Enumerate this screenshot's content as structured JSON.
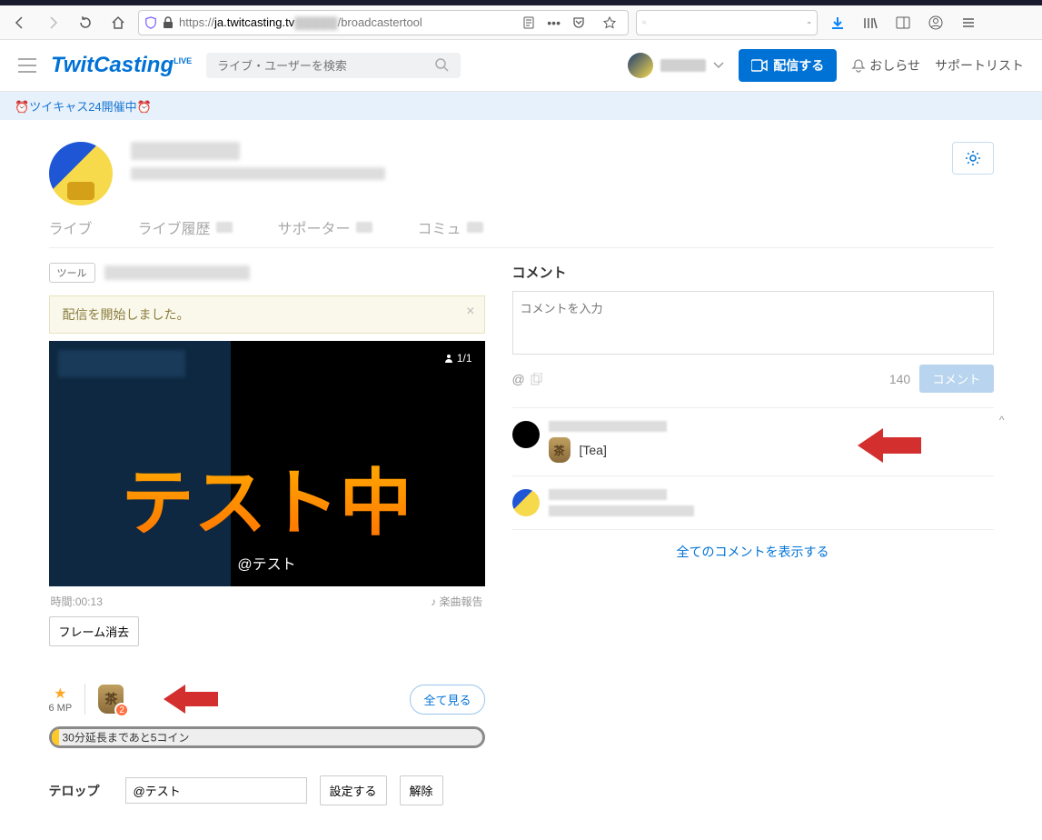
{
  "browser": {
    "url_prefix": "https://",
    "url_domain": "ja.twitcasting.tv",
    "url_suffix": "/broadcastertool"
  },
  "header": {
    "logo": "TwitCasting",
    "logo_sup": "LIVE",
    "search_placeholder": "ライブ・ユーザーを検索",
    "broadcast_btn": "配信する",
    "notice_link": "おしらせ",
    "support_link": "サポートリスト"
  },
  "banner": {
    "text": "ツイキャス24開催中",
    "emoji": "⏰"
  },
  "tabs": {
    "live": "ライブ",
    "history": "ライブ履歴",
    "supporter": "サポーター",
    "community": "コミュ"
  },
  "tool": {
    "label": "ツール"
  },
  "notice": {
    "text": "配信を開始しました。"
  },
  "player": {
    "viewer_count": "1/1",
    "overlay_text": "テスト中",
    "overlay_sub": "@テスト",
    "time_label": "時間:00:13",
    "music_report": "♪ 楽曲報告",
    "clear_frame": "フレーム消去"
  },
  "mp": {
    "star": "★",
    "value": "6 MP",
    "tea_badge": "2",
    "see_all": "全て見る"
  },
  "progress": {
    "text": "30分延長まであと5コイン"
  },
  "telop": {
    "label": "テロップ",
    "value": "@テスト",
    "set_btn": "設定する",
    "clear_btn": "解除"
  },
  "comments": {
    "title": "コメント",
    "placeholder": "コメントを入力",
    "at": "@",
    "char_count": "140",
    "submit": "コメント",
    "tea_text": "[Tea]",
    "show_all": "全てのコメントを表示する"
  }
}
